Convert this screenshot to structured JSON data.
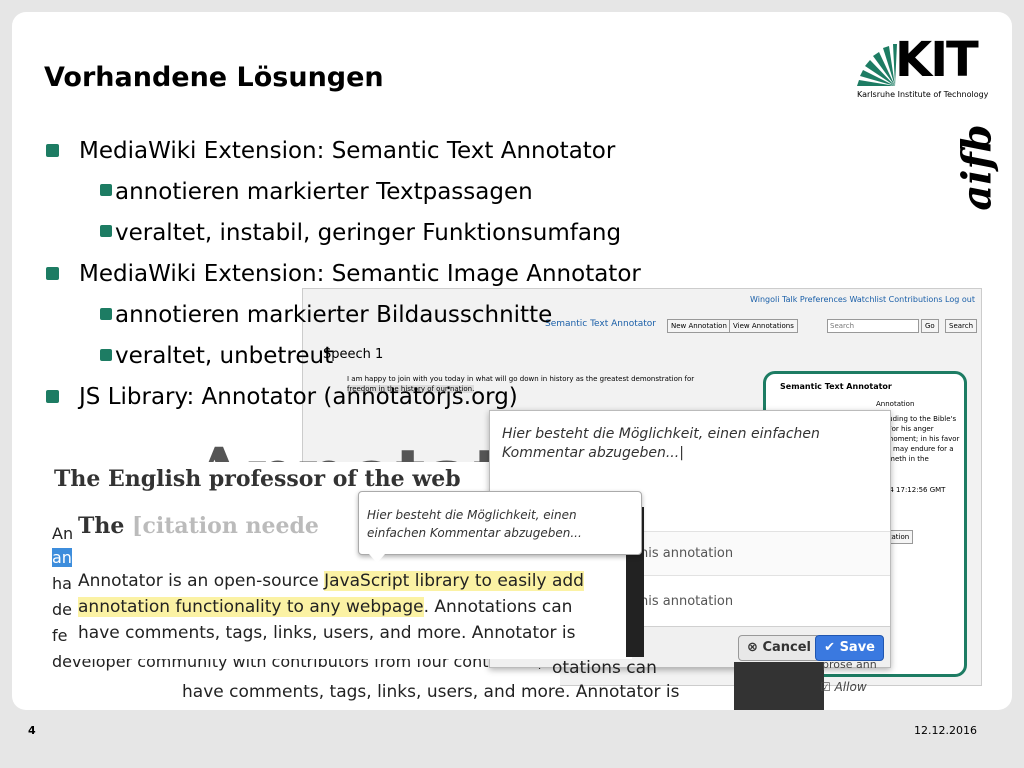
{
  "slide": {
    "title": "Vorhandene Lösungen",
    "logo_kit": "KIT",
    "logo_kit_subtitle": "Karlsruhe Institute of Technology",
    "logo_aifb": "aifb",
    "page_number": "4",
    "date": "12.12.2016"
  },
  "bullets": [
    {
      "level": 1,
      "text": "MediaWiki Extension: Semantic Text Annotator"
    },
    {
      "level": 2,
      "text": "annotieren markierter Textpassagen"
    },
    {
      "level": 2,
      "text": "veraltet, instabil, geringer Funktionsumfang"
    },
    {
      "level": 1,
      "text": "MediaWiki Extension: Semantic Image Annotator"
    },
    {
      "level": 2,
      "text": "annotieren markierter Bildausschnitte"
    },
    {
      "level": 2,
      "text": "veraltet, unbetreut"
    },
    {
      "level": 1,
      "text": "JS Library: Annotator (annotatorjs.org)"
    }
  ],
  "wiki": {
    "top_links": "Wingoli  Talk  Preferences  Watchlist  Contributions  Log out",
    "tab_label": "Semantic Text Annotator",
    "new_annotation_btn": "New Annotation",
    "view_annotations_btn": "View Annotations",
    "search_placeholder": "Search",
    "go_btn": "Go",
    "search_btn": "Search",
    "speech_heading": "Speech 1",
    "line1": "I am happy to join with you today in what will go down in history as the greatest demonstration for",
    "line2": "freedom in the history of our nation.",
    "panel_title": "Semantic Text Annotator",
    "panel_annotation": "Annotation",
    "panel_lines": [
      "alluding to the Bible's",
      ": \"For his anger",
      "a moment; in his favor",
      "ing may endure for a",
      "cometh in the"
    ],
    "panel_time": "2014 17:12:56 GMT",
    "panel_btn": "notation"
  },
  "popup": {
    "text": "Hier besteht die Möglichkeit, einen einfachen Kommentar abzugeben...|",
    "row1": "his annotation",
    "row2": "his annotation",
    "cancel": "Cancel",
    "save": "Save"
  },
  "annotator_site": {
    "big_word": "Annotat",
    "english_title": "The English professor of the web",
    "left_lines": [
      "An",
      "an",
      "ha",
      "de",
      "fe"
    ],
    "mid_title": "The",
    "mid_cite": "[citation neede",
    "mid_line1_a": "Annotator is an open-source ",
    "mid_line1_b": "JavaScript library to easily add",
    "mid_line2_a": "annotation functionality to any webpage",
    "mid_line2_b": ". Annotations can",
    "mid_line3": "have comments, tags, links, users, and more. Annotator is",
    "bottom1": "developer community with contributors from four continents,",
    "bottom2": "have comments, tags, links, users, and more. Annotator is",
    "bottom3": "otations can",
    "tooltip": "Hier besteht die Möglichkeit, einen einfachen Kommentar abzugeben...",
    "prose": "prose ann",
    "allow": "Allow"
  }
}
